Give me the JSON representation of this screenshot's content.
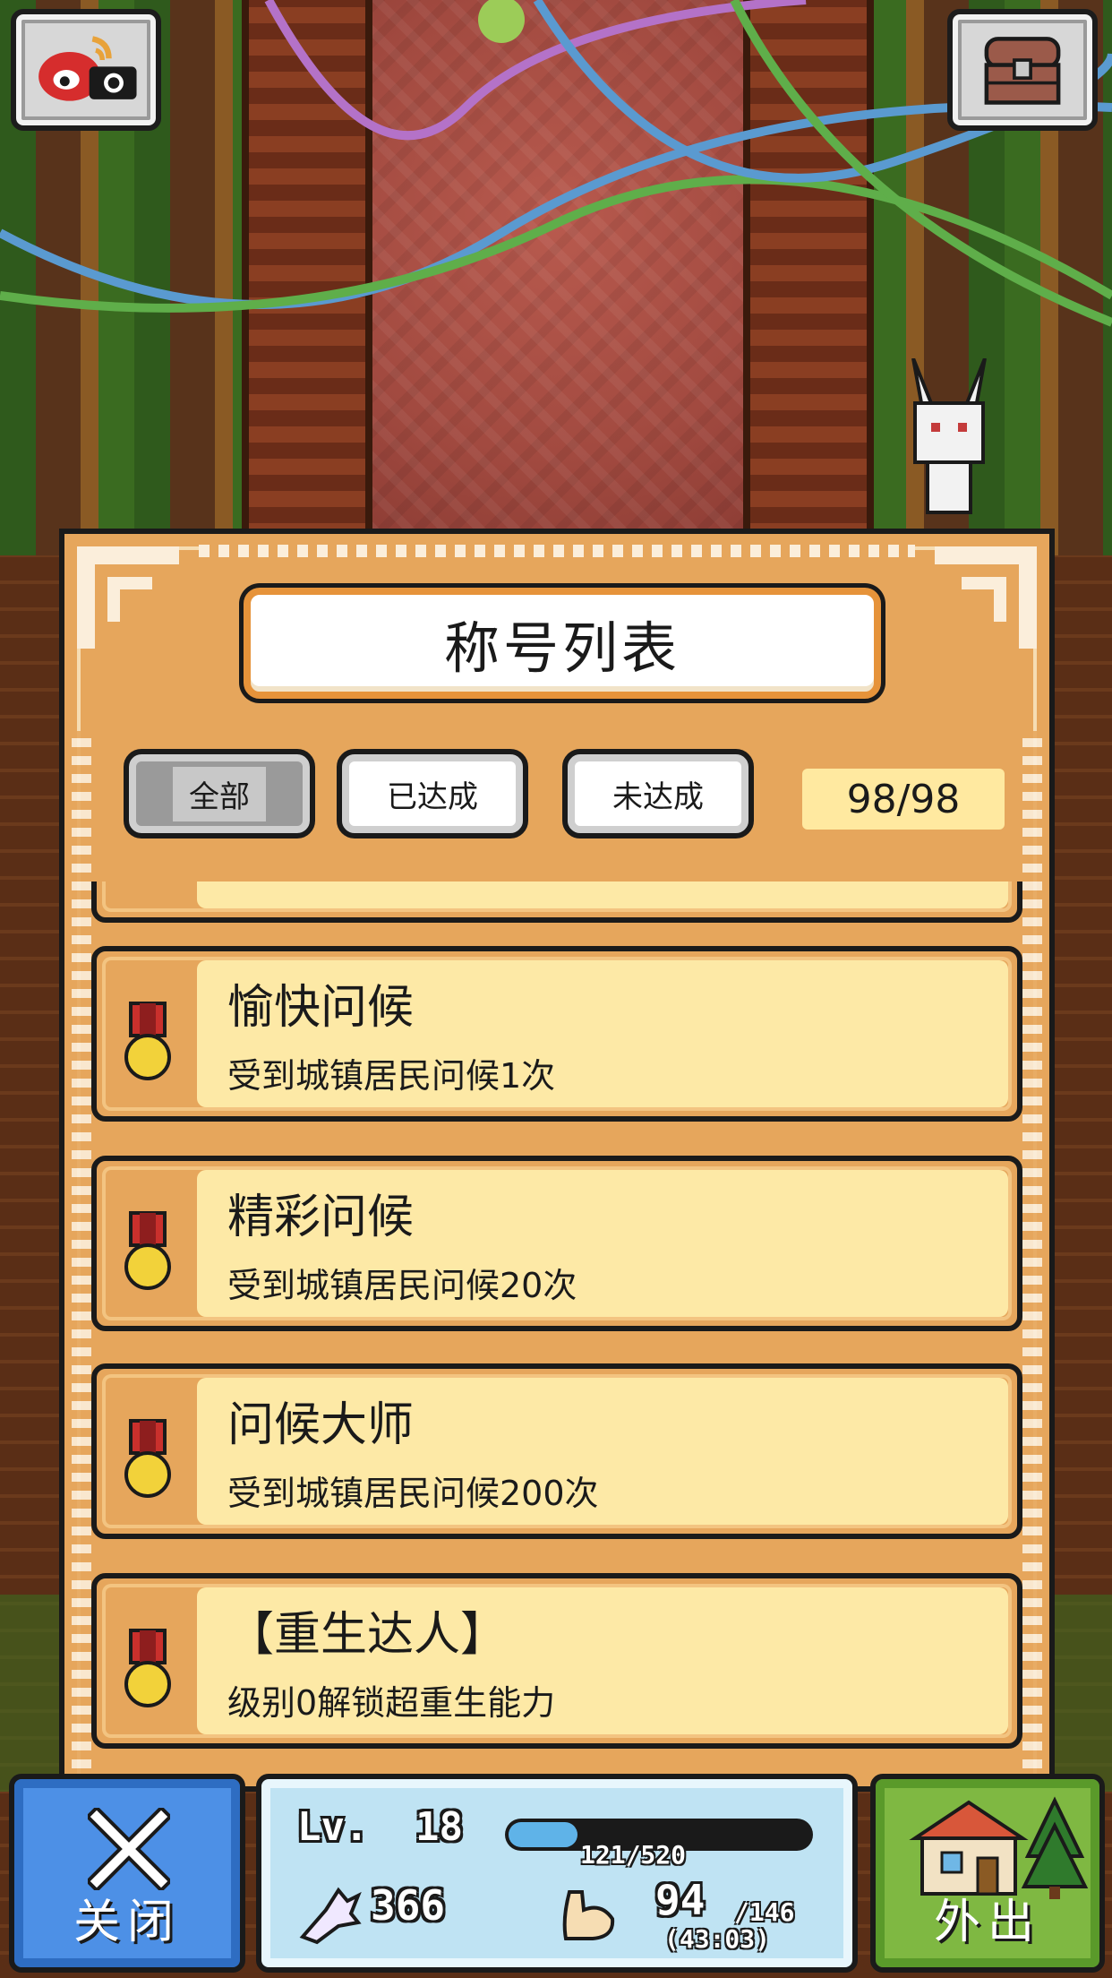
{
  "panel": {
    "title": "称号列表",
    "filters": [
      {
        "label": "全部",
        "active": true
      },
      {
        "label": "已达成",
        "active": false
      },
      {
        "label": "未达成",
        "active": false
      }
    ],
    "count": "98/98"
  },
  "titles": [
    {
      "name": "愉快问候",
      "desc": "受到城镇居民问候1次"
    },
    {
      "name": "精彩问候",
      "desc": "受到城镇居民问候20次"
    },
    {
      "name": "问候大师",
      "desc": "受到城镇居民问候200次"
    },
    {
      "name": "【重生达人】",
      "desc": "级别0解锁超重生能力"
    }
  ],
  "bottom_bar": {
    "close_label": "关闭",
    "out_label": "外出",
    "level_label": "Lv.",
    "level": "18",
    "xp_text": "121/520",
    "xp_fraction": 0.23,
    "money": "366",
    "stamina": "94",
    "stamina_max": "/146",
    "timer": "(43:03)"
  },
  "icons": {
    "weibo": "weibo-camera-icon",
    "chest": "treasure-chest-icon",
    "medal": "medal-icon",
    "close": "close-x-icon",
    "money": "wing-coin-icon",
    "stamina": "muscle-arm-icon",
    "out": "house-tree-icon"
  },
  "colors": {
    "panel_bg": "#e6a65c",
    "card_bg": "#fde9a6",
    "close_btn": "#4d90e6",
    "out_btn": "#7fb842",
    "status_bg": "#bfe3f3"
  }
}
